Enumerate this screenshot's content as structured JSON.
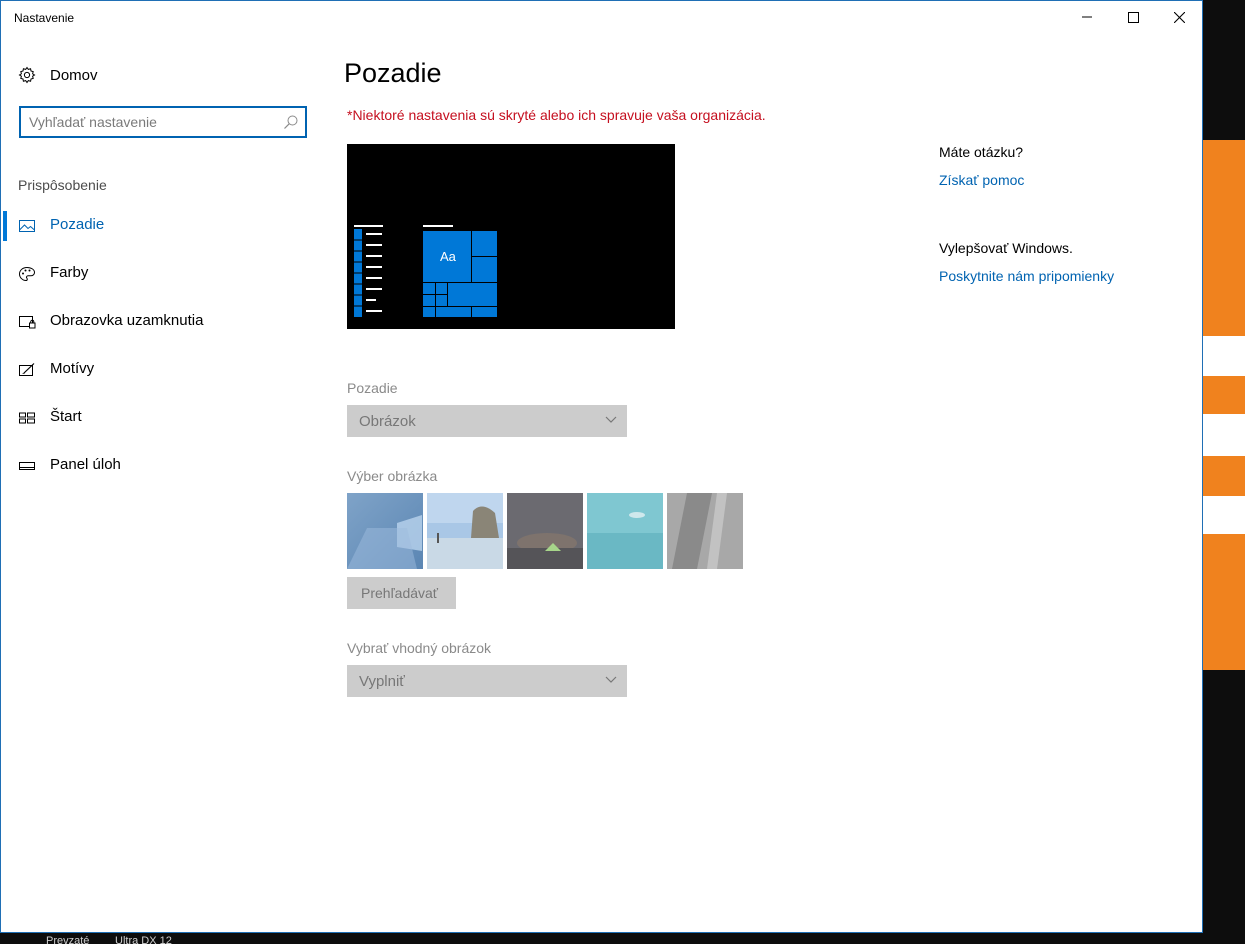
{
  "window": {
    "title": "Nastavenie"
  },
  "sidebar": {
    "home_label": "Domov",
    "search_placeholder": "Vyhľadať nastavenie",
    "section_label": "Prispôsobenie",
    "items": [
      {
        "label": "Pozadie",
        "icon": "picture-icon",
        "active": true
      },
      {
        "label": "Farby",
        "icon": "palette-icon",
        "active": false
      },
      {
        "label": "Obrazovka uzamknutia",
        "icon": "lock-screen-icon",
        "active": false
      },
      {
        "label": "Motívy",
        "icon": "themes-icon",
        "active": false
      },
      {
        "label": "Štart",
        "icon": "start-icon",
        "active": false
      },
      {
        "label": "Panel úloh",
        "icon": "taskbar-icon",
        "active": false
      }
    ]
  },
  "main": {
    "title": "Pozadie",
    "warning": "*Niektoré nastavenia sú skryté alebo ich spravuje vaša organizácia.",
    "preview": {
      "tile_text": "Aa"
    },
    "background_label": "Pozadie",
    "background_value": "Obrázok",
    "choose_picture_label": "Výber obrázka",
    "thumbnails": [
      "windows-default-wallpaper",
      "beach-rock-arch",
      "night-sky-tent",
      "underwater-swimmer",
      "rock-cliff"
    ],
    "browse_label": "Prehľadávať",
    "fit_label": "Vybrať vhodný obrázok",
    "fit_value": "Vyplniť"
  },
  "right": {
    "question": "Máte otázku?",
    "help_link": "Získať pomoc",
    "improve_heading": "Vylepšovať Windows.",
    "feedback_link": "Poskytnite nám pripomienky"
  },
  "taskbar": {
    "items": [
      "Prevzaté",
      "Ultra DX 12"
    ]
  },
  "colors": {
    "accent": "#0078d7",
    "link": "#0063b1",
    "warning": "#c50f1f",
    "disabled_control": "#cccccc"
  }
}
